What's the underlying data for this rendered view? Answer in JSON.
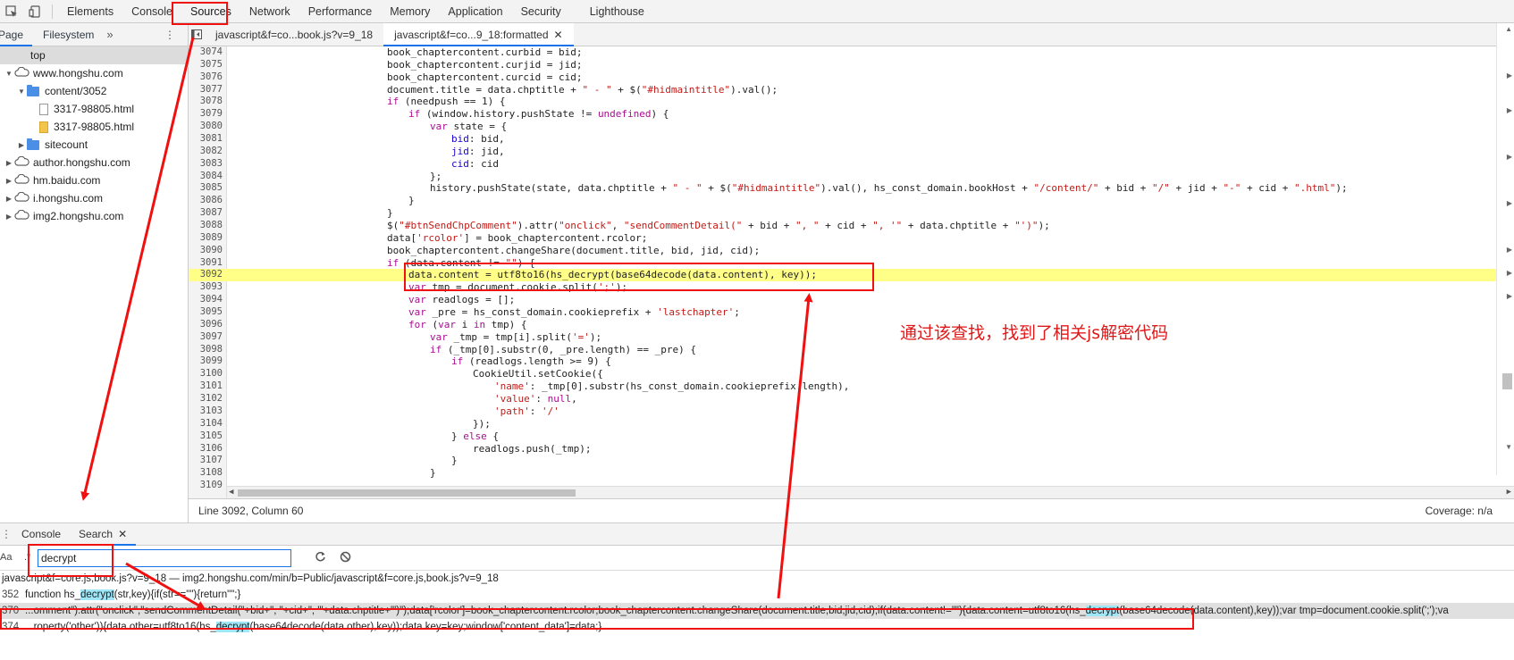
{
  "topbar": {
    "tabs": [
      "Elements",
      "Console",
      "Sources",
      "Network",
      "Performance",
      "Memory",
      "Application",
      "Security",
      "Lighthouse"
    ],
    "active_tab": "Sources"
  },
  "navigator": {
    "tabs": [
      "Page",
      "Filesystem"
    ],
    "more": "»",
    "tree": [
      {
        "label": "top",
        "kind": "frame",
        "depth": 0
      },
      {
        "label": "www.hongshu.com",
        "kind": "domain",
        "depth": 0,
        "expanded": true
      },
      {
        "label": "content/3052",
        "kind": "folder",
        "depth": 1,
        "expanded": true
      },
      {
        "label": "3317-98805.html",
        "kind": "file",
        "depth": 2
      },
      {
        "label": "3317-98805.html",
        "kind": "file-js",
        "depth": 2
      },
      {
        "label": "sitecount",
        "kind": "folder",
        "depth": 1,
        "expanded": false
      },
      {
        "label": "author.hongshu.com",
        "kind": "domain",
        "depth": 0,
        "expanded": false
      },
      {
        "label": "hm.baidu.com",
        "kind": "domain",
        "depth": 0,
        "expanded": false
      },
      {
        "label": "i.hongshu.com",
        "kind": "domain",
        "depth": 0,
        "expanded": false
      },
      {
        "label": "img2.hongshu.com",
        "kind": "domain",
        "depth": 0,
        "expanded": false
      }
    ]
  },
  "editor": {
    "tabs": [
      {
        "label": "javascript&f=co...book.js?v=9_18",
        "closable": false
      },
      {
        "label": "javascript&f=co...9_18:formatted",
        "closable": true
      }
    ],
    "active_tab": 1,
    "highlight_line": 3092,
    "lines": [
      {
        "n": "3074",
        "indent": 0,
        "text": "book_chaptercontent.curbid = bid;"
      },
      {
        "n": "3075",
        "indent": 0,
        "text": "book_chaptercontent.curjid = jid;"
      },
      {
        "n": "3076",
        "indent": 0,
        "text": "book_chaptercontent.curcid = cid;"
      },
      {
        "n": "3077",
        "indent": 0,
        "text": "document.title = data.chptitle + \" - \" + $(\"#hidmaintitle\").val();"
      },
      {
        "n": "3078",
        "indent": 0,
        "text": "if (needpush == 1) {"
      },
      {
        "n": "3079",
        "indent": 1,
        "text": "if (window.history.pushState != undefined) {"
      },
      {
        "n": "3080",
        "indent": 2,
        "text": "var state = {"
      },
      {
        "n": "3081",
        "indent": 3,
        "text": "bid: bid,"
      },
      {
        "n": "3082",
        "indent": 3,
        "text": "jid: jid,"
      },
      {
        "n": "3083",
        "indent": 3,
        "text": "cid: cid"
      },
      {
        "n": "3084",
        "indent": 2,
        "text": "};"
      },
      {
        "n": "3085",
        "indent": 2,
        "text": "history.pushState(state, data.chptitle + \" - \" + $(\"#hidmaintitle\").val(), hs_const_domain.bookHost + \"/content/\" + bid + \"/\" + jid + \"-\" + cid + \".html\");"
      },
      {
        "n": "3086",
        "indent": 1,
        "text": "}"
      },
      {
        "n": "3087",
        "indent": 0,
        "text": "}"
      },
      {
        "n": "3088",
        "indent": 0,
        "text": "$(\"#btnSendChpComment\").attr(\"onclick\", \"sendCommentDetail(\" + bid + \", \" + cid + \", '\" + data.chptitle + \"')\");"
      },
      {
        "n": "3089",
        "indent": 0,
        "text": "data['rcolor'] = book_chaptercontent.rcolor;"
      },
      {
        "n": "3090",
        "indent": 0,
        "text": "book_chaptercontent.changeShare(document.title, bid, jid, cid);"
      },
      {
        "n": "3091",
        "indent": 0,
        "text": "if (data.content != \"\") {"
      },
      {
        "n": "3092",
        "indent": 1,
        "text": "data.content = utf8to16(hs_decrypt(base64decode(data.content), key));"
      },
      {
        "n": "3093",
        "indent": 1,
        "text": "var tmp = document.cookie.split(';');"
      },
      {
        "n": "3094",
        "indent": 1,
        "text": "var readlogs = [];"
      },
      {
        "n": "3095",
        "indent": 1,
        "text": "var _pre = hs_const_domain.cookieprefix + 'lastchapter';"
      },
      {
        "n": "3096",
        "indent": 1,
        "text": "for (var i in tmp) {"
      },
      {
        "n": "3097",
        "indent": 2,
        "text": "var _tmp = tmp[i].split('=');"
      },
      {
        "n": "3098",
        "indent": 2,
        "text": "if (_tmp[0].substr(0, _pre.length) == _pre) {"
      },
      {
        "n": "3099",
        "indent": 3,
        "text": "if (readlogs.length >= 9) {"
      },
      {
        "n": "3100",
        "indent": 4,
        "text": "CookieUtil.setCookie({"
      },
      {
        "n": "3101",
        "indent": 5,
        "text": "'name': _tmp[0].substr(hs_const_domain.cookieprefix.length),"
      },
      {
        "n": "3102",
        "indent": 5,
        "text": "'value': null,"
      },
      {
        "n": "3103",
        "indent": 5,
        "text": "'path': '/'"
      },
      {
        "n": "3104",
        "indent": 4,
        "text": "});"
      },
      {
        "n": "3105",
        "indent": 3,
        "text": "} else {"
      },
      {
        "n": "3106",
        "indent": 4,
        "text": "readlogs.push(_tmp);"
      },
      {
        "n": "3107",
        "indent": 3,
        "text": "}"
      },
      {
        "n": "3108",
        "indent": 2,
        "text": "}"
      },
      {
        "n": "3109",
        "indent": 1,
        "text": ""
      }
    ],
    "status_position": "Line 3092, Column 60",
    "coverage": "Coverage: n/a"
  },
  "drawer": {
    "tabs": [
      "Console",
      "Search"
    ],
    "active_tab": "Search",
    "search": {
      "match_case_label": "Aa",
      "regex_label": ".*",
      "query": "decrypt"
    },
    "results_file": "javascript&f=core.js,book.js?v=9_18 — img2.hongshu.com/min/b=Public/javascript&f=core.js,book.js?v=9_18",
    "results": [
      {
        "line": "352",
        "before": "function hs_",
        "match": "decrypt",
        "after": "(str,key){if(str==\"\"){return\"\";}"
      },
      {
        "line": "370",
        "before": "...omment\").attr(\"onclick\",\"sendCommentDetail(\"+bid+\", \"+cid+\", '\"+data.chptitle+\"')\");data['rcolor']=book_chaptercontent.rcolor;book_chaptercontent.changeShare(document.title,bid,jid,cid);if(data.content!=\"\"){data.content=utf8to16(hs_",
        "match": "decrypt",
        "after": "(base64decode(data.content),key));var tmp=document.cookie.split(';');va"
      },
      {
        "line": "374",
        "before": "...roperty('other')){data.other=utf8to16(hs_",
        "match": "decrypt",
        "after": "(base64decode(data.other),key));data.key=key;window['content_data']=data;}"
      }
    ]
  },
  "annotation": {
    "text": "通过该查找，找到了相关js解密代码",
    "color": "#e01818"
  }
}
